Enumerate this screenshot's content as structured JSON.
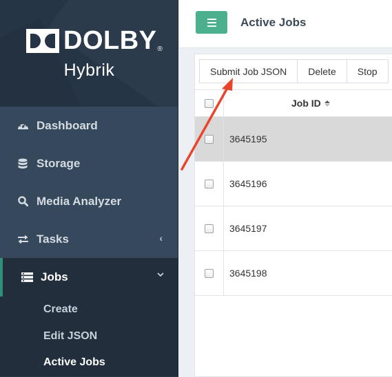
{
  "brand": {
    "logo_text": "DOLBY",
    "reg_mark": "®",
    "product": "Hybrik"
  },
  "sidebar": {
    "items": [
      {
        "label": "Dashboard",
        "icon": "dashboard-icon"
      },
      {
        "label": "Storage",
        "icon": "database-icon"
      },
      {
        "label": "Media Analyzer",
        "icon": "search-icon"
      },
      {
        "label": "Tasks",
        "icon": "exchange-icon",
        "chevron": "‹"
      },
      {
        "label": "Jobs",
        "icon": "list-icon",
        "chevron": "⌄",
        "active": true
      }
    ],
    "jobs_submenu": [
      {
        "label": "Create"
      },
      {
        "label": "Edit JSON"
      },
      {
        "label": "Active Jobs",
        "current": true
      }
    ]
  },
  "header": {
    "page_title": "Active Jobs"
  },
  "toolbar": {
    "submit_label": "Submit Job JSON",
    "delete_label": "Delete",
    "stop_label": "Stop"
  },
  "table": {
    "columns": [
      "Job ID"
    ],
    "rows": [
      {
        "job_id": "3645195",
        "selected": true
      },
      {
        "job_id": "3645196",
        "selected": false
      },
      {
        "job_id": "3645197",
        "selected": false
      },
      {
        "job_id": "3645198",
        "selected": false
      }
    ]
  },
  "colors": {
    "accent": "#4cb08f",
    "sidebar": "#2c3b4c",
    "annotation_arrow": "#e8452c"
  }
}
